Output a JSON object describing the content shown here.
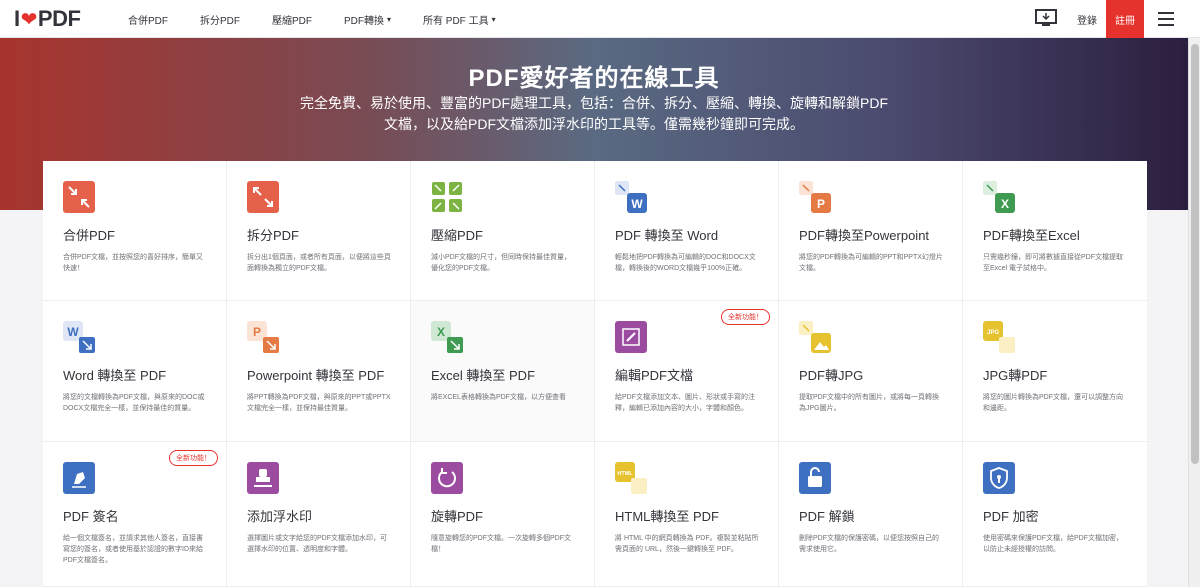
{
  "header": {
    "logo_left": "I",
    "logo_right": "PDF",
    "nav": [
      {
        "label": "合併PDF"
      },
      {
        "label": "拆分PDF"
      },
      {
        "label": "壓縮PDF"
      },
      {
        "label": "PDF轉換",
        "caret": "▾"
      },
      {
        "label": "所有 PDF 工具",
        "caret": "▾"
      }
    ],
    "login": "登錄",
    "signup": "註冊"
  },
  "hero": {
    "title": "PDF愛好者的在線工具",
    "subtitle": "完全免費、易於使用、豐富的PDF處理工具，包括：合併、拆分、壓縮、轉換、旋轉和解鎖PDF文檔，以及給PDF文檔添加浮水印的工具等。僅需幾秒鐘即可完成。"
  },
  "tools": [
    {
      "title": "合併PDF",
      "desc": "合併PDF文檔，並按照您的喜好排序，簡單又快速！",
      "icon": "merge-icon",
      "color": "#e5614a"
    },
    {
      "title": "拆分PDF",
      "desc": "拆分出1個頁面，或者所有頁面，以便將這些頁面轉換為獨立的PDF文檔。",
      "icon": "split-icon",
      "color": "#e5614a"
    },
    {
      "title": "壓縮PDF",
      "desc": "減小PDF文檔的尺寸，但同時保持最佳質量，優化您的PDF文檔。",
      "icon": "compress-icon",
      "color": "#7cb342"
    },
    {
      "title": "PDF 轉換至 Word",
      "desc": "輕鬆地把PDF轉換為可編輯的DOC和DOCX文檔，轉換後的WORD文檔幾乎100%正確。",
      "icon": "pdf-to-word-icon",
      "color": "#3f6fc0"
    },
    {
      "title": "PDF轉換至Powerpoint",
      "desc": "將您的PDF轉換為可編輯的PPT和PPTX幻燈片文檔。",
      "icon": "pdf-to-powerpoint-icon",
      "color": "#e57a44"
    },
    {
      "title": "PDF轉換至Excel",
      "desc": "只需幾秒鐘，即可將數據直接從PDF文檔提取至Excel 電子試格中。",
      "icon": "pdf-to-excel-icon",
      "color": "#3f9a52"
    },
    {
      "title": "Word 轉換至 PDF",
      "desc": "將您的文檔轉換為PDF文檔，與原來的DOC或DOCX文檔完全一樣，並保持最佳的質量。",
      "icon": "word-to-pdf-icon",
      "color": "#3f6fc0"
    },
    {
      "title": "Powerpoint 轉換至 PDF",
      "desc": "將PPT轉換為PDF文檔，與原來的PPT或PPTX文檔完全一樣，並保持最佳質量。",
      "icon": "powerpoint-to-pdf-icon",
      "color": "#e57a44"
    },
    {
      "title": "Excel 轉換至 PDF",
      "desc": "將EXCEL表格轉換為PDF文檔，以方便查看",
      "icon": "excel-to-pdf-icon",
      "color": "#3f9a52"
    },
    {
      "title": "編輯PDF文檔",
      "desc": "給PDF文檔添加文本、圖片、形狀或手寫的注釋，編輯已添加內容的大小，字體和顏色。",
      "icon": "edit-pdf-icon",
      "color": "#9b4ca0",
      "badge": "全新功能！"
    },
    {
      "title": "PDF轉JPG",
      "desc": "提取PDF文檔中的所有圖片，或將每一頁轉換為JPG圖片。",
      "icon": "pdf-to-jpg-icon",
      "color": "#e5c22e"
    },
    {
      "title": "JPG轉PDF",
      "desc": "將您的圖片轉換為PDF文檔，還可以調整方向和邊距。",
      "icon": "jpg-to-pdf-icon",
      "color": "#e5c22e"
    },
    {
      "title": "PDF 簽名",
      "desc": "給一個文檔簽名，並請求其他人簽名，直接書寫您的簽名，或者使用基於認證的數字ID來給PDF文檔簽名。",
      "icon": "sign-pdf-icon",
      "color": "#3f6fc0",
      "badge": "全新功能！"
    },
    {
      "title": "添加浮水印",
      "desc": "選擇圖片或文字給您的PDF文檔添加水印，可選擇水印的位置、透明度和字體。",
      "icon": "watermark-icon",
      "color": "#9b4ca0"
    },
    {
      "title": "旋轉PDF",
      "desc": "隨意旋轉您的PDF文檔。一次旋轉多個PDF文檔！",
      "icon": "rotate-icon",
      "color": "#9b4ca0"
    },
    {
      "title": "HTML轉換至 PDF",
      "desc": "將 HTML 中的網頁轉換為 PDF。複製並粘貼所需頁面的 URL，然後一鍵轉換至 PDF。",
      "icon": "html-to-pdf-icon",
      "color": "#e5c22e"
    },
    {
      "title": "PDF 解鎖",
      "desc": "刪除PDF文檔的保護密碼，以便您按照自己的需求使用它。",
      "icon": "unlock-icon",
      "color": "#3f6fc0"
    },
    {
      "title": "PDF 加密",
      "desc": "使用密碼來保護PDF文檔，給PDF文檔加密，以防止未經授權的訪問。",
      "icon": "protect-icon",
      "color": "#3f6fc0"
    }
  ]
}
